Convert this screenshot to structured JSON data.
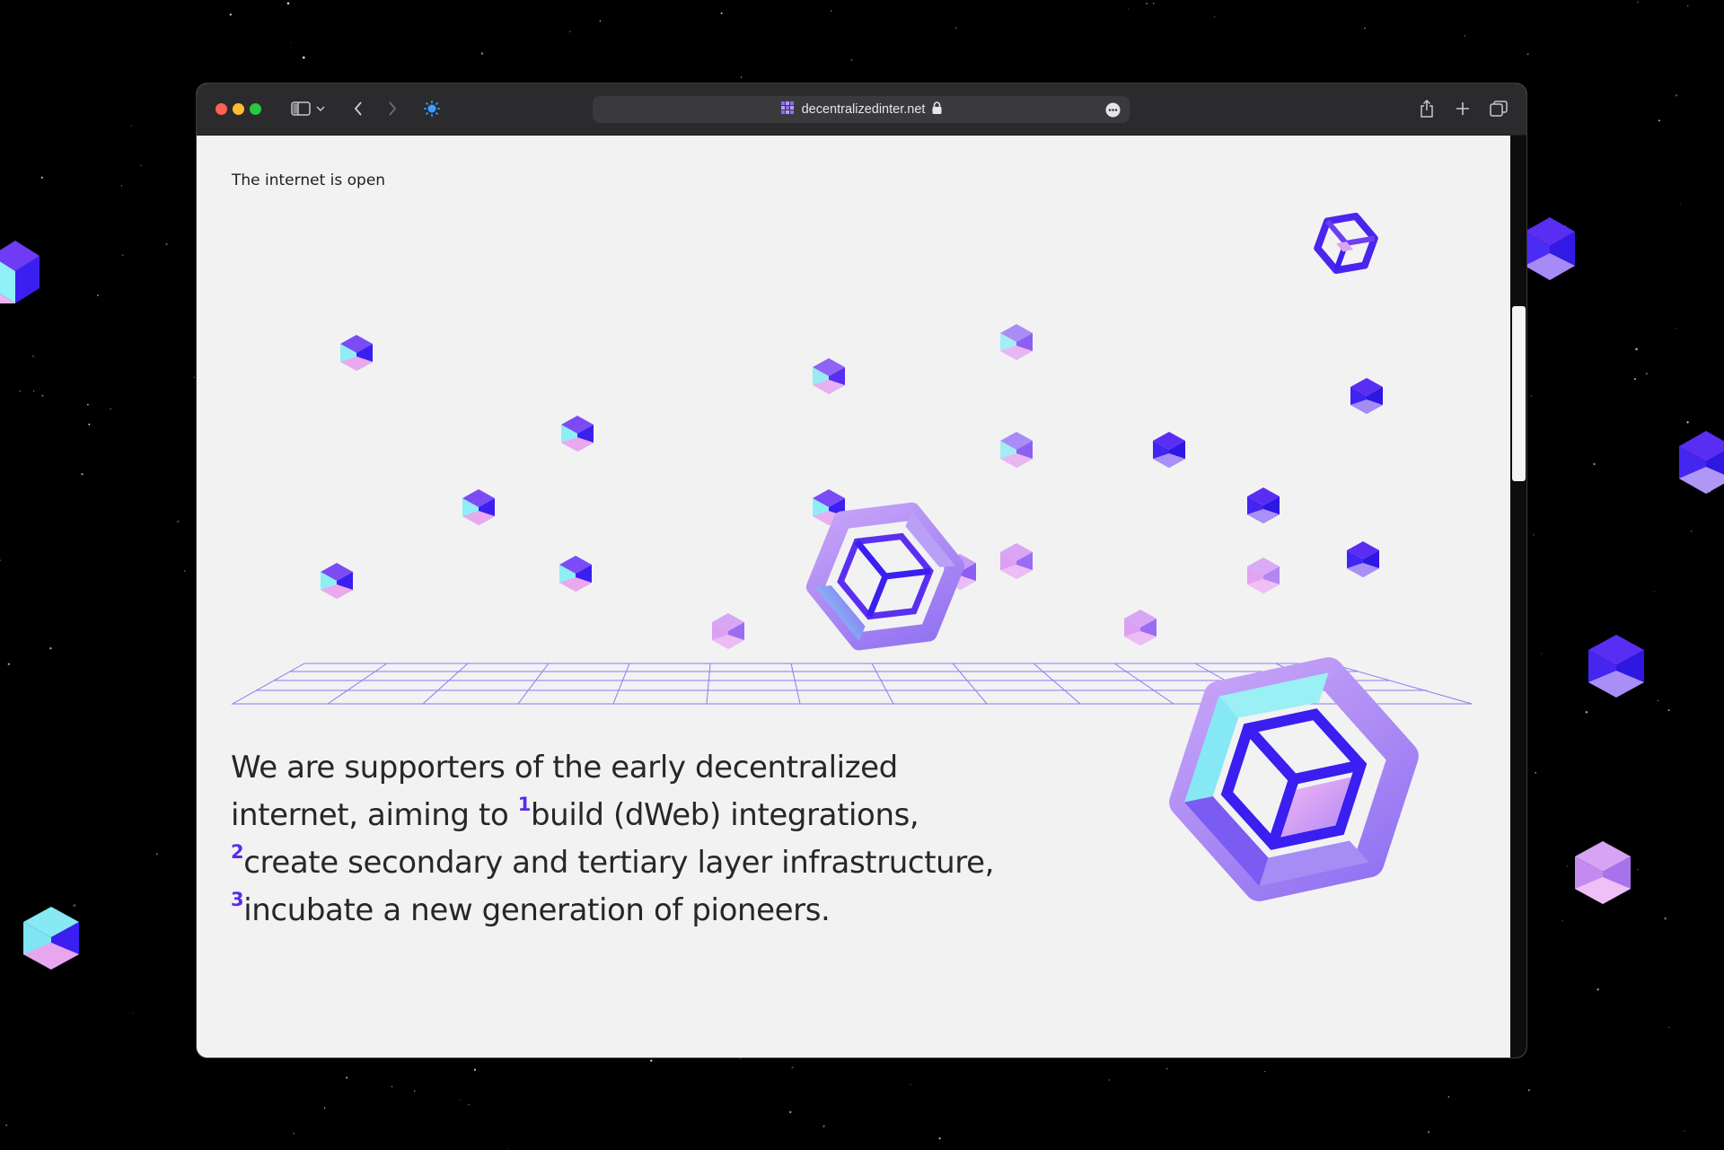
{
  "browser": {
    "url": "decentralizedinter.net",
    "icons": [
      "close-dot",
      "minimize-dot",
      "zoom-dot",
      "sidebar-icon",
      "chevron-down-icon",
      "back-icon",
      "forward-icon",
      "site-bug-icon",
      "site-favicon",
      "lock-icon",
      "more-icon",
      "share-icon",
      "new-tab-icon",
      "tabs-overview-icon"
    ]
  },
  "page": {
    "label": "The internet is open",
    "hero": {
      "part1": "We are supporters of the early decentralized internet, aiming to ",
      "n1": "1",
      "part2": "build (dWeb) integrations, ",
      "n2": "2",
      "part3": "create secondary and tertiary layer infrastructure, ",
      "n3": "3",
      "part4": "incubate a new generation of pioneers."
    }
  },
  "colors": {
    "background": "#000000",
    "page": "#f2f2f3",
    "accent": "#5a2ae8",
    "cube_blue": "#3b1ef2",
    "cube_cyan": "#7ee7f2",
    "cube_lilac": "#b58bf6",
    "cube_pink": "#e4a2ee"
  }
}
